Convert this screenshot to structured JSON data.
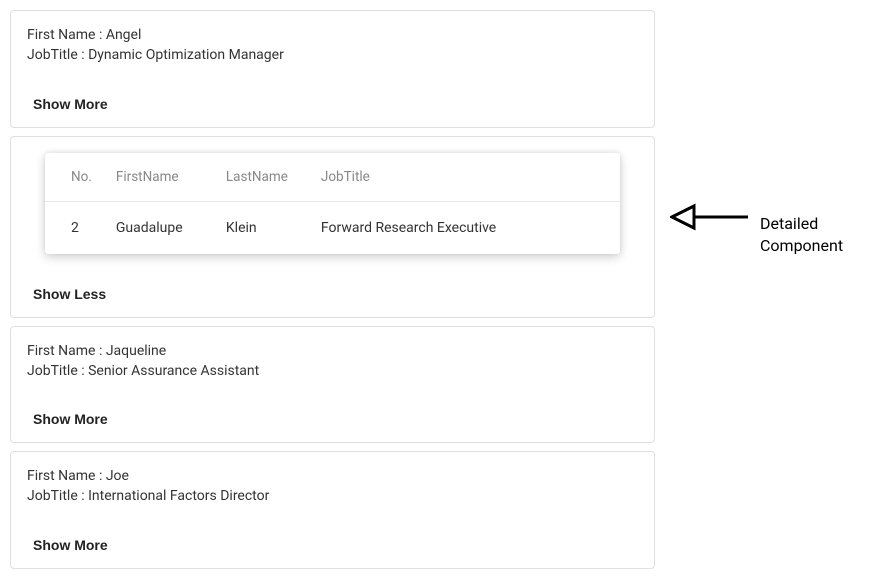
{
  "labels": {
    "first_name_prefix": "First Name : ",
    "job_title_prefix": "JobTitle : ",
    "show_more": "Show More",
    "show_less": "Show Less"
  },
  "cards": {
    "0": {
      "first_name": "Angel",
      "job_title": "Dynamic Optimization Manager"
    },
    "1": {
      "detail": {
        "headers": {
          "no": "No.",
          "first_name": "FirstName",
          "last_name": "LastName",
          "job_title": "JobTitle"
        },
        "row": {
          "no": "2",
          "first_name": "Guadalupe",
          "last_name": "Klein",
          "job_title": "Forward Research Executive"
        }
      }
    },
    "2": {
      "first_name": "Jaqueline",
      "job_title": "Senior Assurance Assistant"
    },
    "3": {
      "first_name": "Joe",
      "job_title": "International Factors Director"
    }
  },
  "annotation": {
    "line1": "Detailed",
    "line2": "Component"
  }
}
